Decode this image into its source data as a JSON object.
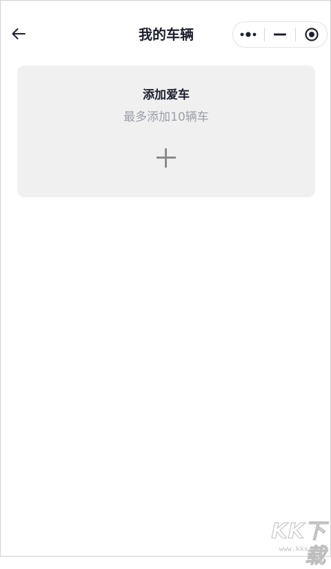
{
  "header": {
    "title": "我的车辆",
    "back_icon": "arrow-left-icon",
    "capsule": {
      "more_icon": "more-dots-icon",
      "minimize_icon": "minimize-icon",
      "close_icon": "target-close-icon"
    }
  },
  "card": {
    "title": "添加爱车",
    "subtitle": "最多添加10辆车",
    "add_icon": "plus-icon"
  },
  "watermark": {
    "logo": "KK下载",
    "url": "www.kkx.net"
  },
  "colors": {
    "title_text": "#1c1f2e",
    "subtitle_text": "#9a9ea8",
    "card_background": "#f0f0f0",
    "plus_icon": "#8a8a8a"
  }
}
